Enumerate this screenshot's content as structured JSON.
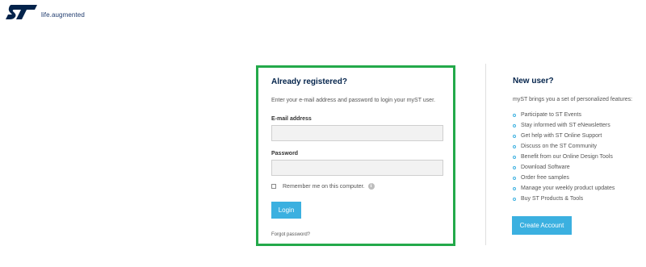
{
  "header": {
    "logo_tagline": "life.augmented",
    "brand_color": "#03234b"
  },
  "login": {
    "title": "Already registered?",
    "intro": "Enter your e-mail address and password to login your myST user.",
    "email_label": "E-mail address",
    "email_value": "",
    "password_label": "Password",
    "password_value": "",
    "remember_label": "Remember me on this computer.",
    "remember_checked": false,
    "info_icon": "info-icon",
    "login_button": "Login",
    "forgot_link": "Forgot password?",
    "highlight_color": "#23a94a"
  },
  "new_user": {
    "title": "New user?",
    "intro": "myST brings you a set of personalized features:",
    "features": [
      "Participate to ST Events",
      "Stay informed with ST eNewsletters",
      "Get help with ST Online Support",
      "Discuss on the ST Community",
      "Benefit from our Online Design Tools",
      "Download Software",
      "Order free samples",
      "Manage your weekly product updates",
      "Buy ST Products & Tools"
    ],
    "create_button": "Create Account",
    "accent_color": "#3bb0e0"
  }
}
